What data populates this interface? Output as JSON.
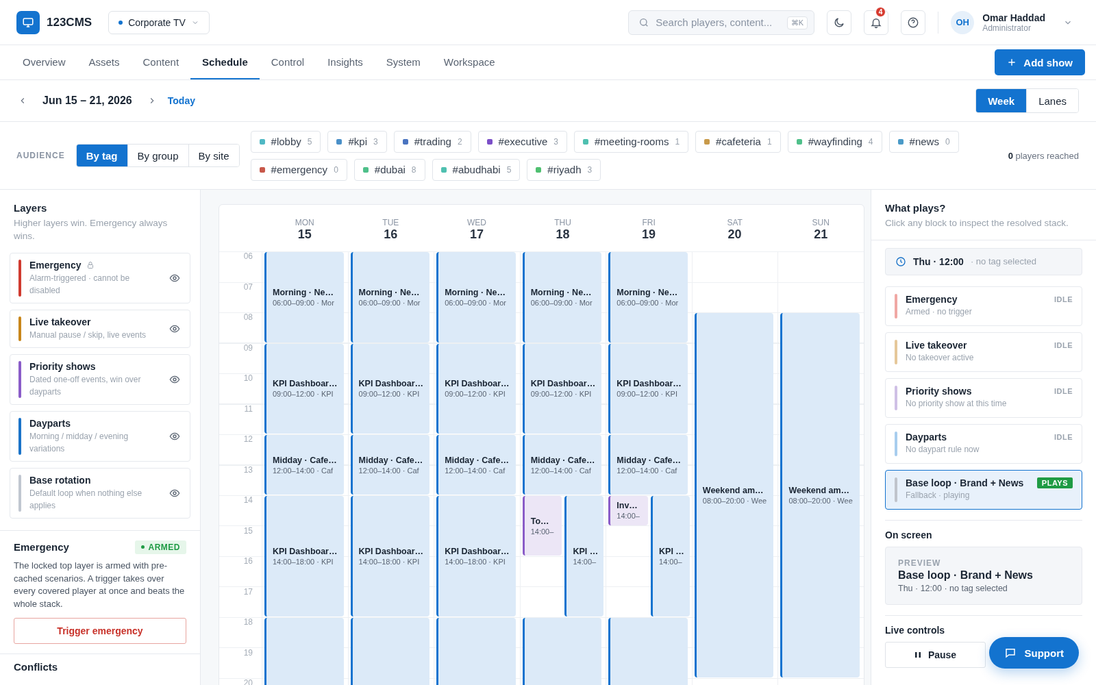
{
  "brand": {
    "name": "123CMS"
  },
  "workspace": {
    "label": "Corporate TV"
  },
  "search": {
    "placeholder": "Search players, content...",
    "shortcut": "⌘K"
  },
  "notifications": {
    "count": "4"
  },
  "user": {
    "initials": "OH",
    "name": "Omar Haddad",
    "role": "Administrator"
  },
  "nav": [
    {
      "label": "Overview",
      "selected": false
    },
    {
      "label": "Assets",
      "selected": false
    },
    {
      "label": "Content",
      "selected": false
    },
    {
      "label": "Schedule",
      "selected": true
    },
    {
      "label": "Control",
      "selected": false
    },
    {
      "label": "Insights",
      "selected": false
    },
    {
      "label": "System",
      "selected": false
    },
    {
      "label": "Workspace",
      "selected": false
    }
  ],
  "add_button": "Add show",
  "date_range": {
    "label": "Jun 15 – 21, 2026",
    "today": "Today"
  },
  "views": [
    {
      "label": "Week",
      "selected": true
    },
    {
      "label": "Lanes",
      "selected": false
    }
  ],
  "audience": {
    "label": "AUDIENCE",
    "modes": [
      {
        "label": "By tag",
        "selected": true
      },
      {
        "label": "By group",
        "selected": false
      },
      {
        "label": "By site",
        "selected": false
      }
    ],
    "tags": [
      {
        "name": "#lobby",
        "count": "5",
        "color": "#4fb8c4"
      },
      {
        "name": "#kpi",
        "count": "3",
        "color": "#4a90c8"
      },
      {
        "name": "#trading",
        "count": "2",
        "color": "#4a74c0"
      },
      {
        "name": "#executive",
        "count": "3",
        "color": "#7b4fc8"
      },
      {
        "name": "#meeting-rooms",
        "count": "1",
        "color": "#4fc0b0"
      },
      {
        "name": "#cafeteria",
        "count": "1",
        "color": "#c89a4a"
      },
      {
        "name": "#wayfinding",
        "count": "4",
        "color": "#4fc08a"
      },
      {
        "name": "#news",
        "count": "0",
        "color": "#4a9ac8"
      },
      {
        "name": "#emergency",
        "count": "0",
        "color": "#c8584a"
      },
      {
        "name": "#dubai",
        "count": "8",
        "color": "#4fc08a"
      },
      {
        "name": "#abudhabi",
        "count": "5",
        "color": "#4fc0b0"
      },
      {
        "name": "#riyadh",
        "count": "3",
        "color": "#4fc070"
      }
    ],
    "reached": "**0** players reached"
  },
  "layers": {
    "title": "Layers",
    "subtitle": "Higher layers win. Emergency always wins.",
    "items": [
      {
        "name": "Emergency",
        "detail": "Alarm-triggered · cannot be disabled",
        "color": "#d03a2f",
        "locked": true
      },
      {
        "name": "Live takeover",
        "detail": "Manual pause / skip, live events",
        "color": "#c8861a",
        "locked": false
      },
      {
        "name": "Priority shows",
        "detail": "Dated one-off events, win over dayparts",
        "color": "#8a5cc8",
        "locked": false
      },
      {
        "name": "Dayparts",
        "detail": "Morning / midday / evening variations",
        "color": "#1a73c8",
        "locked": false
      },
      {
        "name": "Base rotation",
        "detail": "Default loop when nothing else applies",
        "color": "#c0c6d0",
        "locked": false
      }
    ]
  },
  "emergency": {
    "title": "Emergency",
    "status": "ARMED",
    "text": "The locked top layer is armed with pre-cached scenarios. A trigger takes over every covered player at once and beats the whole stack.",
    "button": "Trigger emergency"
  },
  "conflicts": {
    "title": "Conflicts"
  },
  "calendar": {
    "hours": [
      "06",
      "07",
      "08",
      "09",
      "10",
      "11",
      "12",
      "13",
      "14",
      "15",
      "16",
      "17",
      "18",
      "19",
      "20"
    ],
    "days": [
      {
        "name": "MON",
        "date": "15",
        "blocks": [
          {
            "kind": "morning",
            "title": "Morning · Ne…",
            "detail": "06:00–09:00 · Mor"
          },
          {
            "kind": "forenoon",
            "title": "KPI Dashboar…",
            "detail": "09:00–12:00 · KPI"
          },
          {
            "kind": "midday",
            "title": "Midday · Cafe…",
            "detail": "12:00–14:00 · Caf"
          },
          {
            "kind": "afternoon",
            "title": "KPI Dashboar…",
            "detail": "14:00–18:00 · KPI"
          },
          {
            "kind": "evening"
          }
        ]
      },
      {
        "name": "TUE",
        "date": "16",
        "blocks": [
          {
            "kind": "morning",
            "title": "Morning · Ne…",
            "detail": "06:00–09:00 · Mor"
          },
          {
            "kind": "forenoon",
            "title": "KPI Dashboar…",
            "detail": "09:00–12:00 · KPI"
          },
          {
            "kind": "midday",
            "title": "Midday · Cafe…",
            "detail": "12:00–14:00 · Caf"
          },
          {
            "kind": "afternoon",
            "title": "KPI Dashboar…",
            "detail": "14:00–18:00 · KPI"
          },
          {
            "kind": "evening"
          }
        ]
      },
      {
        "name": "WED",
        "date": "17",
        "blocks": [
          {
            "kind": "morning",
            "title": "Morning · Ne…",
            "detail": "06:00–09:00 · Mor"
          },
          {
            "kind": "forenoon",
            "title": "KPI Dashboar…",
            "detail": "09:00–12:00 · KPI"
          },
          {
            "kind": "midday",
            "title": "Midday · Cafe…",
            "detail": "12:00–14:00 · Caf"
          },
          {
            "kind": "afternoon",
            "title": "KPI Dashboar…",
            "detail": "14:00–18:00 · KPI"
          },
          {
            "kind": "evening"
          }
        ]
      },
      {
        "name": "THU",
        "date": "18",
        "blocks": [
          {
            "kind": "morning",
            "title": "Morning · Ne…",
            "detail": "06:00–09:00 · Mor"
          },
          {
            "kind": "forenoon",
            "title": "KPI Dashboar…",
            "detail": "09:00–12:00 · KPI"
          },
          {
            "kind": "midday",
            "title": "Midday · Cafe…",
            "detail": "12:00–14:00 · Caf"
          },
          {
            "kind": "event",
            "title": "To…",
            "detail": "14:00–"
          },
          {
            "kind": "split",
            "title": "KPI …",
            "detail": "14:00–"
          },
          {
            "kind": "evening"
          }
        ]
      },
      {
        "name": "FRI",
        "date": "19",
        "blocks": [
          {
            "kind": "morning",
            "title": "Morning · Ne…",
            "detail": "06:00–09:00 · Mor"
          },
          {
            "kind": "forenoon",
            "title": "KPI Dashboar…",
            "detail": "09:00–12:00 · KPI"
          },
          {
            "kind": "midday",
            "title": "Midday · Cafe…",
            "detail": "12:00–14:00 · Caf"
          },
          {
            "kind": "flash",
            "title": "Inv…",
            "detail": "14:00–"
          },
          {
            "kind": "split",
            "title": "KPI …",
            "detail": "14:00–"
          },
          {
            "kind": "evening"
          }
        ]
      },
      {
        "name": "SAT",
        "date": "20",
        "blocks": [
          {
            "kind": "weekend",
            "title": "Weekend am…",
            "detail": "08:00–20:00 · Wee"
          }
        ]
      },
      {
        "name": "SUN",
        "date": "21",
        "blocks": [
          {
            "kind": "weekend",
            "title": "Weekend am…",
            "detail": "08:00–20:00 · Wee"
          }
        ]
      }
    ]
  },
  "what_plays": {
    "title": "What plays?",
    "subtitle": "Click any block to inspect the resolved stack.",
    "time": "Thu · 12:00",
    "scope": "· no tag selected",
    "stack": [
      {
        "name": "Emergency",
        "detail": "Armed · no trigger",
        "status": "IDLE",
        "color": "#f0a8a4",
        "active": false
      },
      {
        "name": "Live takeover",
        "detail": "No takeover active",
        "status": "IDLE",
        "color": "#e6c89a",
        "active": false
      },
      {
        "name": "Priority shows",
        "detail": "No priority show at this time",
        "status": "IDLE",
        "color": "#cfc0e6",
        "active": false
      },
      {
        "name": "Dayparts",
        "detail": "No daypart rule now",
        "status": "IDLE",
        "color": "#a8cdee",
        "active": false
      },
      {
        "name": "Base loop · Brand + News",
        "detail": "Fallback · playing",
        "status": "PLAYS",
        "color": "#c0c4cc",
        "active": true
      }
    ]
  },
  "on_screen": {
    "title": "On screen",
    "label": "PREVIEW",
    "name": "Base loop · Brand + News",
    "detail": "Thu · 12:00 · no tag selected"
  },
  "live_controls": {
    "title": "Live controls",
    "buttons": [
      "Pause"
    ]
  },
  "support": {
    "label": "Support"
  }
}
